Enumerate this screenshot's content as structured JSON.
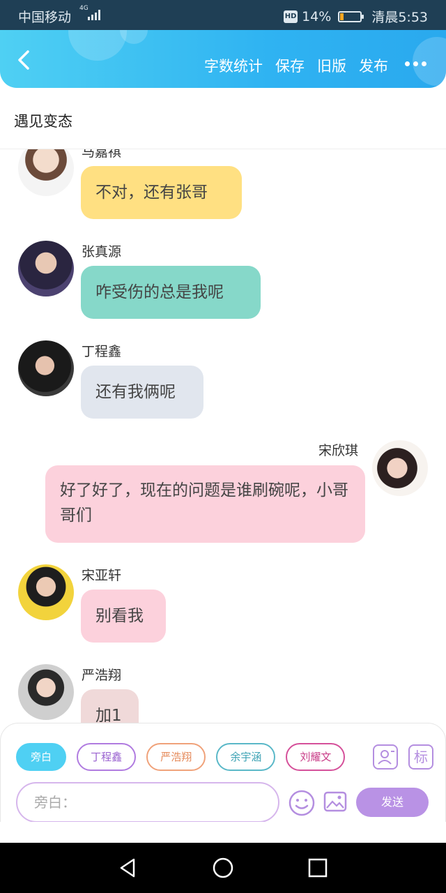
{
  "status": {
    "carrier": "中国移动",
    "network": "4G",
    "battery": "14%",
    "time": "清晨5:53",
    "hd": "HD",
    "battery_level": 0.14
  },
  "header": {
    "actions": [
      "字数统计",
      "保存",
      "旧版",
      "发布"
    ]
  },
  "title": "遇见变态",
  "messages": [
    {
      "name": "马嘉祺",
      "text": "不对，还有张哥",
      "color": "#ffe082",
      "side": "left"
    },
    {
      "name": "张真源",
      "text": "咋受伤的总是我呢",
      "color": "#86d8c9",
      "side": "left"
    },
    {
      "name": "丁程鑫",
      "text": "还有我俩呢",
      "color": "#e1e6ee",
      "side": "left"
    },
    {
      "name": "宋欣琪",
      "text": "好了好了，现在的问题是谁刷碗呢，小哥哥们",
      "color": "#fcd1dc",
      "side": "right"
    },
    {
      "name": "宋亚轩",
      "text": "别看我",
      "color": "#fcd1dc",
      "side": "left"
    },
    {
      "name": "严浩翔",
      "text": "加1",
      "color": "#f0d9d9",
      "side": "left"
    }
  ],
  "chips": [
    {
      "label": "旁白",
      "color": "#4fd0f3"
    },
    {
      "label": "丁程鑫",
      "color": "#b07be0"
    },
    {
      "label": "严浩翔",
      "color": "#f0a27a"
    },
    {
      "label": "余宇涵",
      "color": "#5ab8c8"
    },
    {
      "label": "刘耀文",
      "color": "#d5509a"
    }
  ],
  "input": {
    "placeholder": "旁白："
  },
  "send_label": "发送",
  "mark_label": "标"
}
